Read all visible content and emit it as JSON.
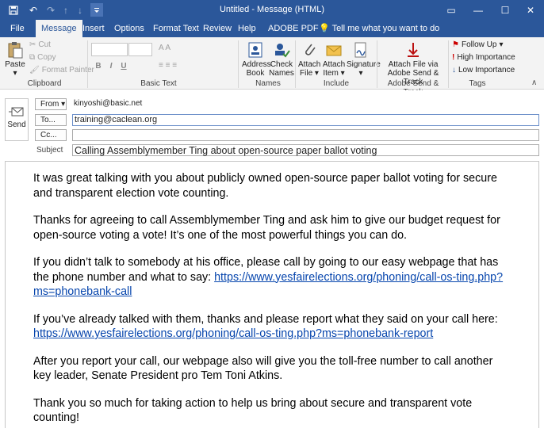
{
  "window": {
    "title": "Untitled  -  Message (HTML)",
    "quick_access": {
      "save": "Save",
      "undo": "Undo",
      "redo": "Redo"
    },
    "controls": {
      "ribbon_options": "▭",
      "minimize": "—",
      "maximize": "☐",
      "close": "✕"
    }
  },
  "tabs": [
    {
      "label": "File"
    },
    {
      "label": "Message"
    },
    {
      "label": "Insert"
    },
    {
      "label": "Options"
    },
    {
      "label": "Format Text"
    },
    {
      "label": "Review"
    },
    {
      "label": "Help"
    },
    {
      "label": "ADOBE PDF"
    }
  ],
  "tell_me": "Tell me what you want to do",
  "ribbon": {
    "clipboard": {
      "label": "Clipboard",
      "paste": "Paste",
      "cut": "Cut",
      "copy": "Copy",
      "format_painter": "Format Painter"
    },
    "basic_text": {
      "label": "Basic Text",
      "bold": "B",
      "italic": "I",
      "underline": "U"
    },
    "names": {
      "label": "Names",
      "address_book": "Address Book",
      "check_names": "Check Names"
    },
    "include": {
      "label": "Include",
      "attach_file": "Attach File",
      "attach_item": "Attach Item",
      "signature": "Signature"
    },
    "adobe": {
      "label": "Adobe Send & Track",
      "attach_via": "Attach File via Adobe Send & Track"
    },
    "tags": {
      "label": "Tags",
      "follow_up": "Follow Up",
      "high_importance": "High Importance",
      "low_importance": "Low Importance"
    }
  },
  "compose": {
    "send_label": "Send",
    "from_label": "From",
    "from_value": "kinyoshi@basic.net",
    "to_label": "To...",
    "to_value": "training@caclean.org",
    "cc_label": "Cc...",
    "cc_value": "",
    "subject_label": "Subject",
    "subject_value": "Calling Assemblymember Ting about open-source paper ballot voting"
  },
  "body": {
    "p1": "It was great talking with you about publicly owned open-source paper ballot voting for secure and transparent election vote counting.",
    "p2": "Thanks for agreeing to call Assemblymember Ting and ask him to give our budget request for open-source voting a vote!  It’s one of the most powerful things you can do.",
    "p3_text": "If you didn’t talk to somebody at his office, please call by going to our easy webpage that has the phone number and what to say: ",
    "p3_link": "https://www.yesfairelections.org/phoning/call-os-ting.php?ms=phonebank-call",
    "p4_text": "If you’ve already talked with them, thanks and please report what they said on your call here: ",
    "p4_link": "https://www.yesfairelections.org/phoning/call-os-ting.php?ms=phonebank-report",
    "p5": "After you report your call, our webpage also will give you the toll-free number to call another key leader, Senate President pro Tem Toni Atkins.",
    "p6": "Thank you so much for taking action to help us bring about secure and transparent vote counting!"
  }
}
